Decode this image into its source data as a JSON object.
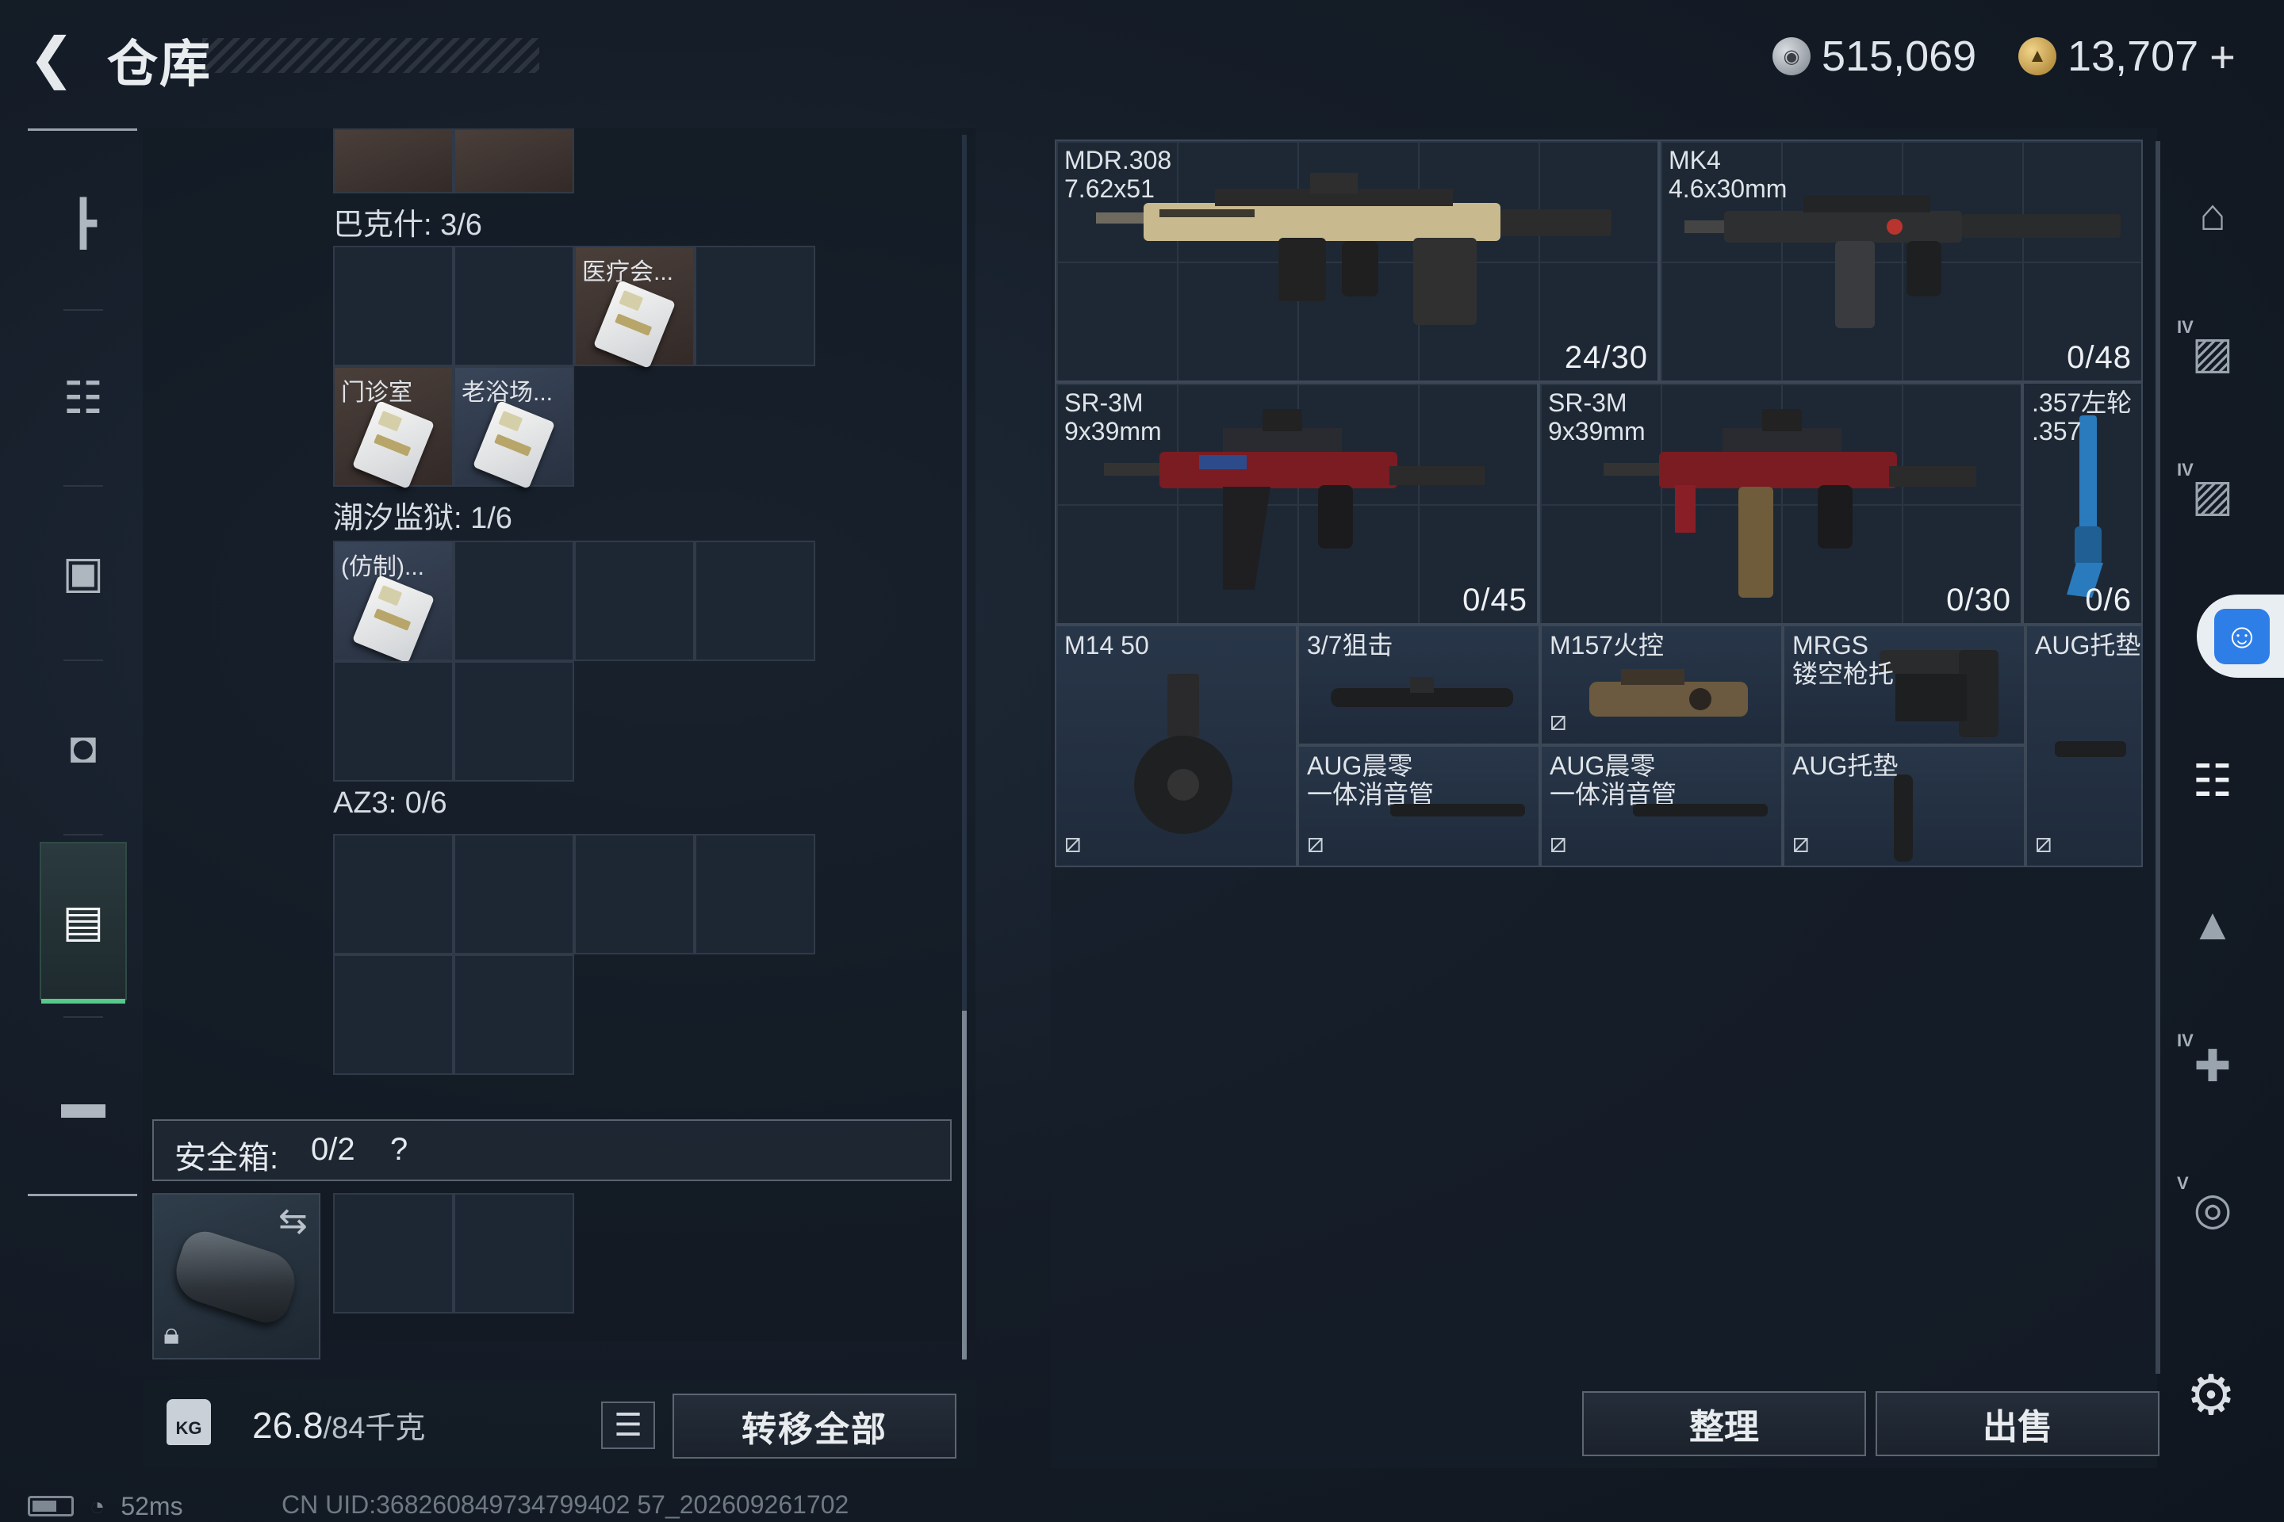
{
  "header": {
    "title": "仓库",
    "currency_silver": "515,069",
    "currency_gold": "13,707"
  },
  "icons": {
    "back": "chevron-left-icon",
    "silver_coin": "silver-coin-icon",
    "gold_coin": "gold-coin-icon",
    "plus": "plus-icon",
    "left_nav": [
      "gun-icon",
      "armor-vest-icon",
      "backpack-icon",
      "chest-rig-icon",
      "container-icon",
      "toolbox-icon"
    ],
    "right_nav": [
      "dome-storage-icon",
      "storage-iv-icon",
      "storage-iv-2-icon",
      "gun-rack-icon",
      "keycard-storage-icon",
      "medical-storage-icon",
      "gear-storage-icon"
    ],
    "settings": "gear-icon",
    "accessibility": "accessibility-icon"
  },
  "inventory": {
    "sections": [
      {
        "label": "巴克什: 3/6"
      },
      {
        "label": "潮汐监狱: 1/6"
      },
      {
        "label": "AZ3: 0/6"
      }
    ],
    "items": {
      "medical": "医疗会...",
      "clinic": "门诊室",
      "bathhouse": "老浴场...",
      "replica": "(仿制)..."
    },
    "safebox": {
      "label": "安全箱:",
      "count": "0/2",
      "help": "?"
    }
  },
  "bottom_left": {
    "weight": "26.8",
    "weight_max": "/84千克",
    "kg_badge": "KG",
    "transfer_all": "转移全部"
  },
  "storage": {
    "weapons": [
      {
        "name": "MDR.308\n7.62x51",
        "count": "24/30"
      },
      {
        "name": "MK4\n4.6x30mm",
        "count": "0/48"
      },
      {
        "name": "SR-3M\n9x39mm",
        "count": "0/45"
      },
      {
        "name": "SR-3M\n9x39mm",
        "count": "0/30"
      },
      {
        "name": ".357左轮\n.357",
        "count": "0/6"
      }
    ],
    "attachments": [
      {
        "name": "M14 50"
      },
      {
        "name": "3/7狙击"
      },
      {
        "name": "M157火控"
      },
      {
        "name": "MRGS\n镂空枪托"
      },
      {
        "name": "AUG托垫"
      },
      {
        "name": "AUG晨零\n一体消音管"
      },
      {
        "name": "AUG晨零\n一体消音管"
      },
      {
        "name": "AUG托垫"
      }
    ]
  },
  "bottom_right": {
    "sort": "整理",
    "sell": "出售"
  },
  "status_bar": {
    "ping": "52ms",
    "uid": "CN UID:368260849734799402 57_202609261702"
  }
}
